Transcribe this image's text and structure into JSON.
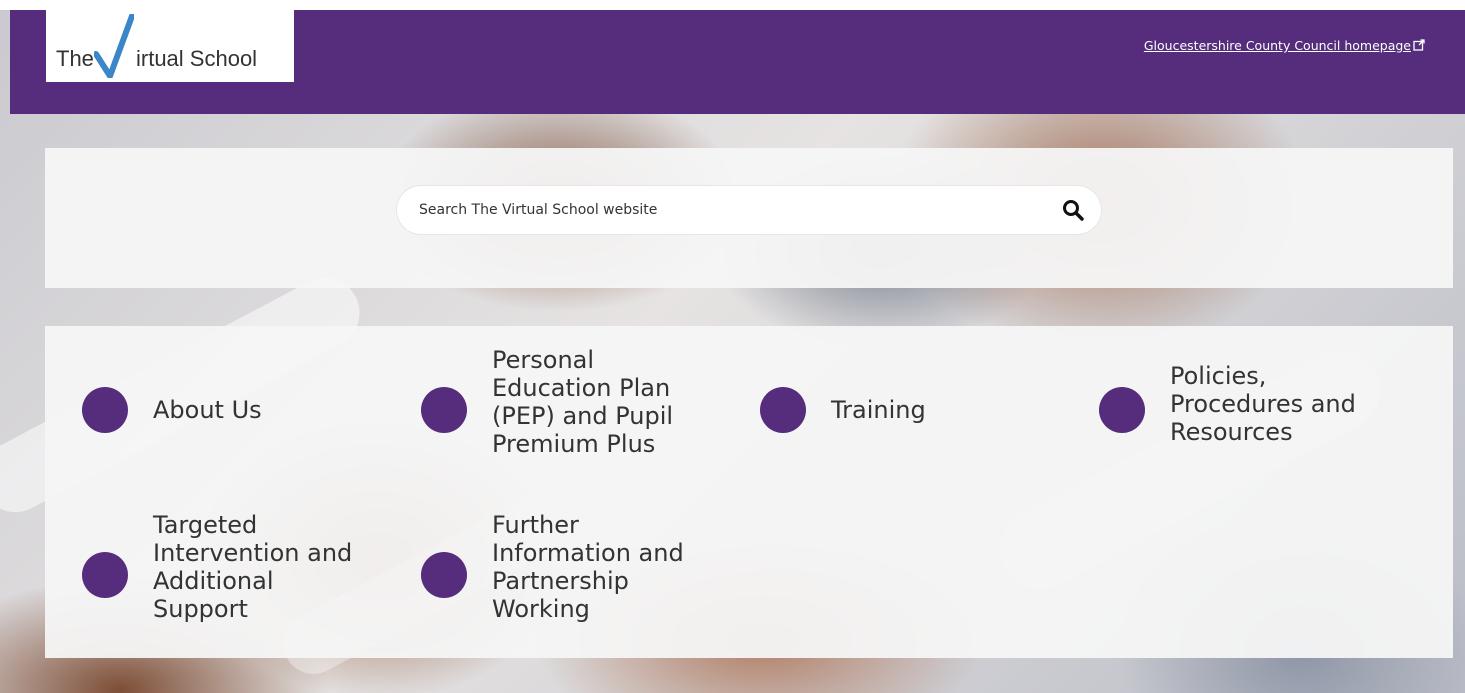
{
  "header": {
    "logo_text_pre": "The",
    "logo_text_post": "irtual School",
    "council_link_label": "Gloucestershire County Council homepage",
    "brand_color": "#562c7d",
    "external_icon": "external-link-icon"
  },
  "search": {
    "placeholder": "Search The Virtual School website",
    "icon": "search-icon"
  },
  "nav": {
    "items": [
      {
        "label_lines": [
          "About Us"
        ]
      },
      {
        "label_lines": [
          "Personal",
          "Education Plan",
          "(PEP) and Pupil",
          "Premium Plus"
        ]
      },
      {
        "label_lines": [
          "Training"
        ]
      },
      {
        "label_lines": [
          "Policies,",
          "Procedures and",
          "Resources"
        ]
      },
      {
        "label_lines": [
          "Targeted",
          "Intervention and",
          "Additional",
          "Support"
        ]
      },
      {
        "label_lines": [
          "Further",
          "Information and",
          "Partnership",
          "Working"
        ]
      }
    ]
  }
}
